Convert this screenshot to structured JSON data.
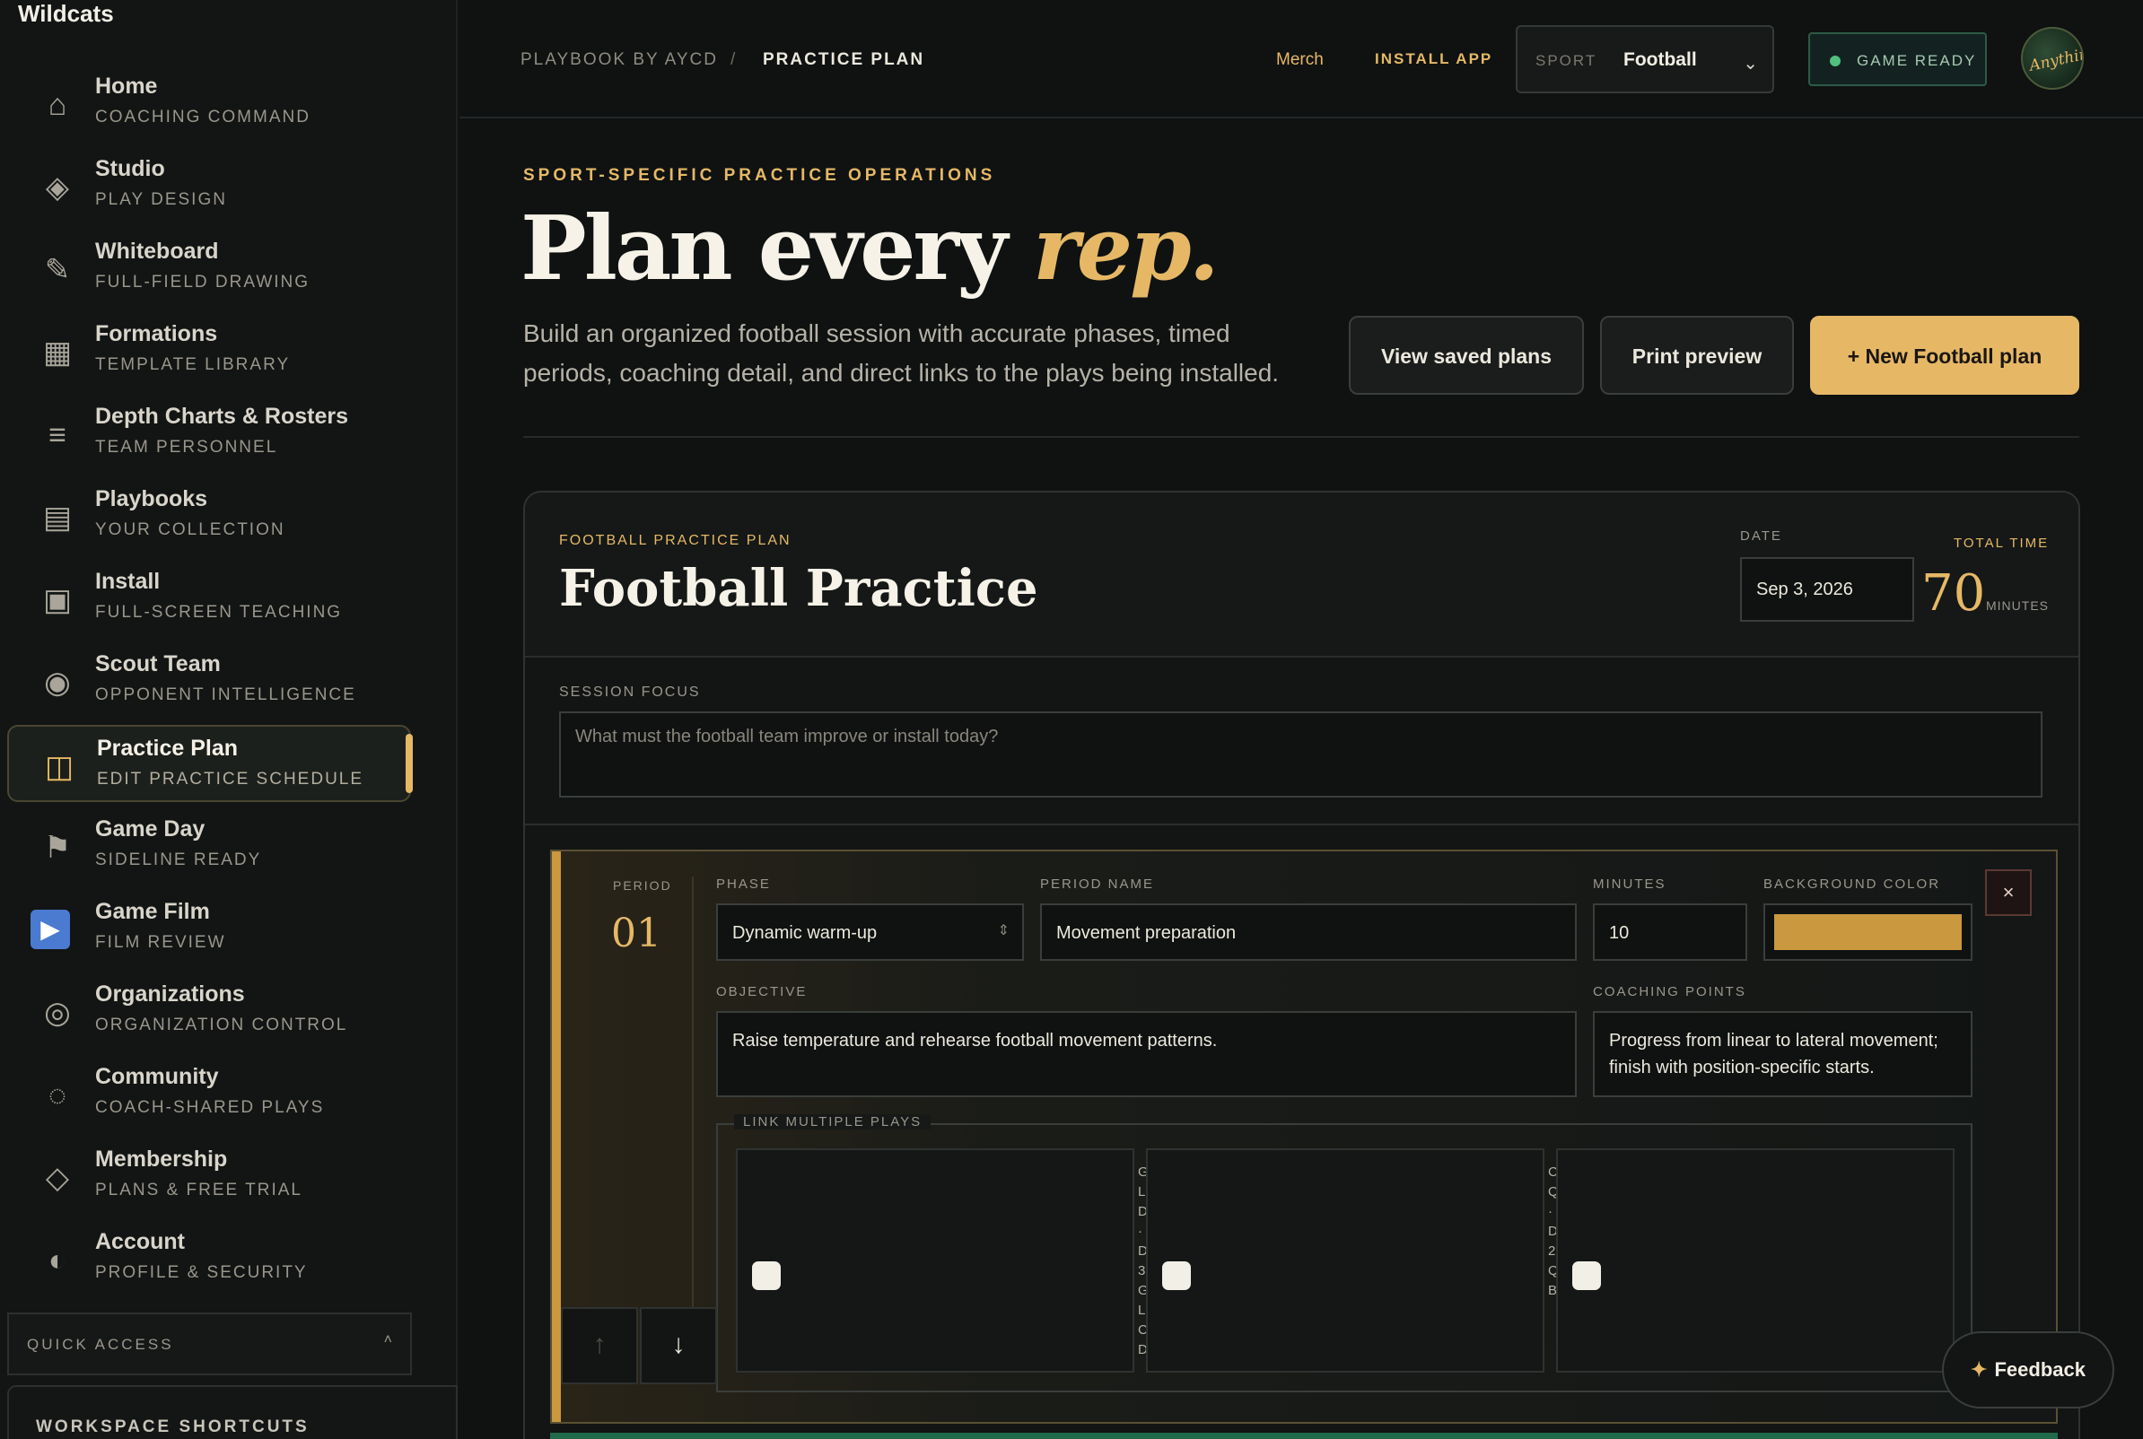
{
  "app": {
    "brand": "Wildcats"
  },
  "sidebar": {
    "items": [
      {
        "label": "Home",
        "sub": "COACHING COMMAND",
        "icon": "home-icon",
        "glyph": "⌂"
      },
      {
        "label": "Studio",
        "sub": "PLAY DESIGN",
        "icon": "diamond-icon",
        "glyph": "◈"
      },
      {
        "label": "Whiteboard",
        "sub": "FULL-FIELD DRAWING",
        "icon": "pencil-icon",
        "glyph": "✎"
      },
      {
        "label": "Formations",
        "sub": "TEMPLATE LIBRARY",
        "icon": "grid-icon",
        "glyph": "▦"
      },
      {
        "label": "Depth Charts & Rosters",
        "sub": "TEAM PERSONNEL",
        "icon": "list-icon",
        "glyph": "≡"
      },
      {
        "label": "Playbooks",
        "sub": "YOUR COLLECTION",
        "icon": "book-icon",
        "glyph": "▤"
      },
      {
        "label": "Install",
        "sub": "FULL-SCREEN TEACHING",
        "icon": "screen-icon",
        "glyph": "▣"
      },
      {
        "label": "Scout Team",
        "sub": "OPPONENT INTELLIGENCE",
        "icon": "target-icon",
        "glyph": "◉"
      },
      {
        "label": "Practice Plan",
        "sub": "EDIT PRACTICE SCHEDULE",
        "icon": "columns-icon",
        "glyph": "◫"
      },
      {
        "label": "Game Day",
        "sub": "SIDELINE READY",
        "icon": "flag-icon",
        "glyph": "⚑"
      },
      {
        "label": "Game Film",
        "sub": "FILM REVIEW",
        "icon": "play-icon",
        "glyph": "▶"
      },
      {
        "label": "Organizations",
        "sub": "ORGANIZATION CONTROL",
        "icon": "ring-icon",
        "glyph": "◎"
      },
      {
        "label": "Community",
        "sub": "COACH-SHARED PLAYS",
        "icon": "dotted-circle-icon",
        "glyph": "◌"
      },
      {
        "label": "Membership",
        "sub": "PLANS & FREE TRIAL",
        "icon": "diamond-outline-icon",
        "glyph": "◇"
      },
      {
        "label": "Account",
        "sub": "PROFILE & SECURITY",
        "icon": "half-circle-icon",
        "glyph": "◐"
      }
    ],
    "quick_access": "QUICK ACCESS",
    "quick_access_chevron": "˄",
    "shortcuts": "WORKSPACE SHORTCUTS"
  },
  "topbar": {
    "crumb_root": "PLAYBOOK BY AYCD",
    "crumb_sep": "/",
    "crumb_current": "PRACTICE PLAN",
    "merch": "Merch",
    "install_app": "INSTALL APP",
    "sport_label": "SPORT",
    "sport_value": "Football",
    "sport_chevron": "⌄",
    "status": "GAME READY",
    "avatar_text": "Anything You Can"
  },
  "hero": {
    "eyebrow": "SPORT-SPECIFIC PRACTICE OPERATIONS",
    "title_a": "Plan every ",
    "title_b": "rep.",
    "desc": "Build an organized football session with accurate phases, timed periods, coaching detail, and direct links to the plays being installed.",
    "btn_saved": "View saved plans",
    "btn_print": "Print preview",
    "btn_new": "+ New Football plan"
  },
  "plan": {
    "eyebrow": "FOOTBALL PRACTICE PLAN",
    "title": "Football Practice",
    "date_label": "DATE",
    "date_value": "Sep 3, 2026",
    "total_label": "TOTAL TIME",
    "total_value": "70",
    "total_unit": "MINUTES",
    "focus_label": "SESSION FOCUS",
    "focus_placeholder": "What must the football team improve or install today?"
  },
  "period": {
    "label": "PERIOD",
    "number": "01",
    "phase_label": "PHASE",
    "phase_value": "Dynamic warm-up",
    "phase_chevron": "⇕",
    "name_label": "PERIOD NAME",
    "name_value": "Movement preparation",
    "minutes_label": "MINUTES",
    "minutes_value": "10",
    "color_label": "BACKGROUND COLOR",
    "color_value": "#c9983f",
    "remove": "×",
    "objective_label": "OBJECTIVE",
    "objective_value": "Raise temperature and rehearse football movement patterns.",
    "coaching_label": "COACHING POINTS",
    "coaching_value": "Progress from linear to lateral movement; finish with position-specific starts.",
    "plays_legend": "LINK MULTIPLE PLAYS",
    "play_fragments": [
      "G\nLi\nD\n·\nD\n3(\nG\nLi\nC\nD",
      "C\nQ\n·\nD\n2!\nQ\nB",
      ""
    ],
    "move_up": "↑",
    "move_down": "↓"
  },
  "feedback": {
    "spark": "✦",
    "label": "Feedback"
  }
}
